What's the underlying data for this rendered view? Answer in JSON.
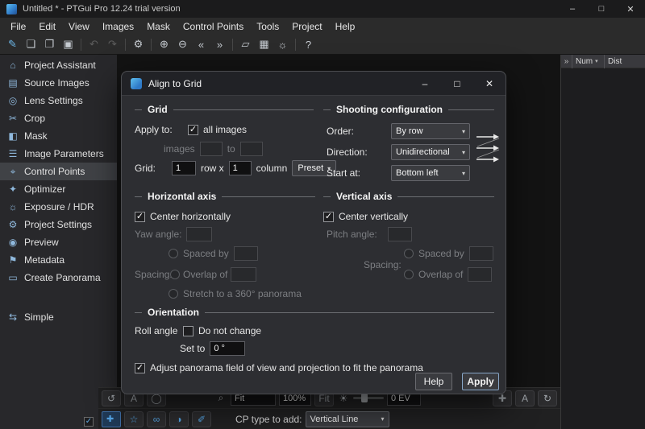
{
  "window": {
    "title": "Untitled * - PTGui Pro 12.24 trial version"
  },
  "menubar": [
    "File",
    "Edit",
    "View",
    "Images",
    "Mask",
    "Control Points",
    "Tools",
    "Project",
    "Help"
  ],
  "toolbar": {
    "icons": [
      {
        "name": "new-project-icon",
        "glyph": "✎"
      },
      {
        "name": "open-project-icon",
        "glyph": "❏"
      },
      {
        "name": "save-as-icon",
        "glyph": "❐"
      },
      {
        "name": "save-icon",
        "glyph": "▣"
      },
      {
        "name": "undo-icon",
        "glyph": "↶"
      },
      {
        "name": "redo-icon",
        "glyph": "↷"
      },
      {
        "name": "settings-icon",
        "glyph": "⚙"
      },
      {
        "name": "zoom-in-icon",
        "glyph": "⊕"
      },
      {
        "name": "zoom-out-icon",
        "glyph": "⊖"
      },
      {
        "name": "previous-images-icon",
        "glyph": "«"
      },
      {
        "name": "next-images-icon",
        "glyph": "»"
      },
      {
        "name": "panorama-editor-icon",
        "glyph": "▱"
      },
      {
        "name": "detail-viewer-icon",
        "glyph": "▦"
      },
      {
        "name": "lamp-icon",
        "glyph": "☼"
      },
      {
        "name": "help-icon",
        "glyph": "?"
      }
    ]
  },
  "sidebar": {
    "items": [
      {
        "label": "Project Assistant",
        "glyph": "⌂"
      },
      {
        "label": "Source Images",
        "glyph": "▤"
      },
      {
        "label": "Lens Settings",
        "glyph": "◎"
      },
      {
        "label": "Crop",
        "glyph": "✂"
      },
      {
        "label": "Mask",
        "glyph": "◧"
      },
      {
        "label": "Image Parameters",
        "glyph": "☰"
      },
      {
        "label": "Control Points",
        "glyph": "⌖"
      },
      {
        "label": "Optimizer",
        "glyph": "✦"
      },
      {
        "label": "Exposure / HDR",
        "glyph": "☼"
      },
      {
        "label": "Project Settings",
        "glyph": "⚙"
      },
      {
        "label": "Preview",
        "glyph": "◉"
      },
      {
        "label": "Metadata",
        "glyph": "⚑"
      },
      {
        "label": "Create Panorama",
        "glyph": "▭"
      }
    ],
    "simple": {
      "label": "Simple",
      "glyph": "⇆"
    }
  },
  "cp_table": {
    "num_header": "Num",
    "dist_header": "Dist"
  },
  "dialog": {
    "title": "Align to Grid",
    "grid": {
      "header": "Grid",
      "apply_to": "Apply to:",
      "all_images": "all images",
      "all_images_checked": true,
      "images": "images",
      "to": "to",
      "images_from_value": "",
      "images_to_value": "",
      "grid_label": "Grid:",
      "rows_value": "1",
      "row_x": "row x",
      "columns_value": "1",
      "column": "column",
      "preset": "Preset"
    },
    "shooting": {
      "header": "Shooting configuration",
      "order_label": "Order:",
      "order_value": "By row",
      "direction_label": "Direction:",
      "direction_value": "Unidirectional",
      "start_label": "Start at:",
      "start_value": "Bottom left"
    },
    "horizontal": {
      "header": "Horizontal axis",
      "center": "Center horizontally",
      "center_checked": true,
      "yaw": "Yaw angle:",
      "yaw_value": "",
      "spacing": "Spacing:",
      "spaced_by": "Spaced by",
      "spaced_by_value": "",
      "overlap_of": "Overlap of",
      "overlap_of_value": "",
      "stretch": "Stretch to a 360° panorama"
    },
    "vertical": {
      "header": "Vertical axis",
      "center": "Center vertically",
      "center_checked": true,
      "pitch": "Pitch angle:",
      "pitch_value": "",
      "spacing": "Spacing:",
      "spaced_by": "Spaced by",
      "spaced_by_value": "",
      "overlap_of": "Overlap of",
      "overlap_of_value": ""
    },
    "orientation": {
      "header": "Orientation",
      "roll": "Roll angle",
      "do_not_change": "Do not change",
      "do_not_change_checked": false,
      "set_to": "Set to",
      "set_to_value": "0 °",
      "adjust": "Adjust panorama field of view and projection to fit the panorama",
      "adjust_checked": true
    },
    "help": "Help",
    "apply": "Apply"
  },
  "bottom": {
    "fit_combo": "Fit",
    "zoom": "100%",
    "fit_button": "Fit",
    "ev": "0 EV",
    "cp_type_label": "CP type to add:",
    "cp_type_value": "Vertical Line"
  },
  "ui": {
    "minimize": "–",
    "maximize": "□",
    "close": "✕",
    "dropdown": "▾",
    "check": "✓",
    "chevrons": "»",
    "magnifier": "⌕",
    "sun": "☀",
    "letter_a": "A",
    "refresh_left": "↺",
    "refresh_right": "↻",
    "circle": "◯",
    "plus_cross": "✚",
    "star": "☆",
    "link": "∞",
    "half": "◑",
    "pencil": "✐"
  },
  "colors": {
    "accent_blue": "#54a4e4",
    "dialog_bg": "#2d2e32",
    "window_bg": "#141414"
  }
}
